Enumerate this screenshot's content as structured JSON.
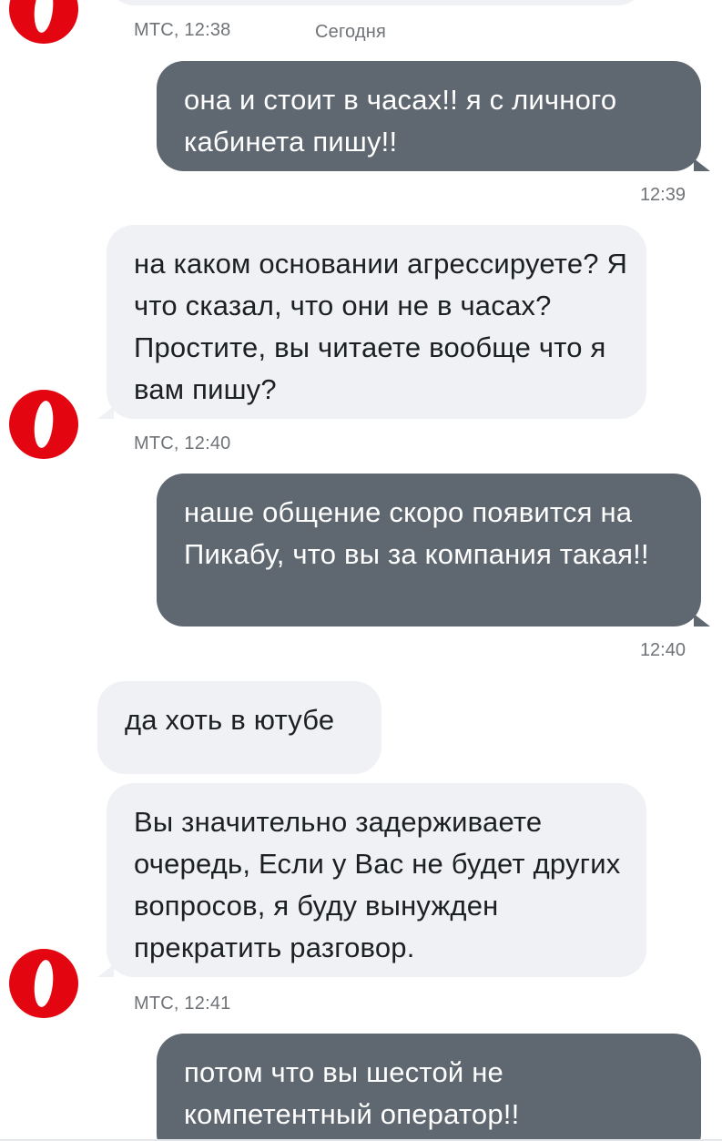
{
  "chat": {
    "brand_color": "#e30611",
    "outgoing_bg": "#5f6870",
    "incoming_bg": "#f0f1f5",
    "header": {
      "sender_time": "МТС, 12:38",
      "date_label": "Сегодня"
    },
    "messages": [
      {
        "dir": "out",
        "text": "она и стоит в часах!! я с личного кабинета пишу!!",
        "time": "12:39"
      },
      {
        "dir": "in",
        "text": "на каком основании агрессируете? Я что сказал, что они не в часах?Простите, вы читаете вообще что я вам пишу?",
        "meta": "МТС, 12:40"
      },
      {
        "dir": "out",
        "text": "наше общение скоро появится на Пикабу, что вы за компания такая!!",
        "time": "12:40"
      },
      {
        "dir": "in",
        "text": "да хоть в ютубе"
      },
      {
        "dir": "in",
        "text": "Вы значительно задерживаете очередь, Если у Вас не будет других вопросов, я буду вынужден прекратить разговор.",
        "meta": "МТС, 12:41"
      },
      {
        "dir": "out",
        "text": "потом что вы шестой не компетентный оператор!!"
      }
    ]
  }
}
